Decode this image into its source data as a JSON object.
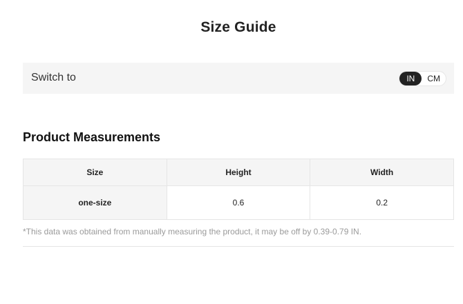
{
  "page": {
    "title": "Size Guide"
  },
  "switch": {
    "label": "Switch to",
    "options": [
      "IN",
      "CM"
    ],
    "selected": "IN"
  },
  "measurements": {
    "title": "Product Measurements",
    "columns": [
      "Size",
      "Height",
      "Width"
    ],
    "rows": [
      [
        "one-size",
        "0.6",
        "0.2"
      ]
    ],
    "note": "*This data was obtained from manually measuring the product, it may be off by 0.39-0.79 IN."
  },
  "colors": {
    "accent": "#222222",
    "panel_bg": "#f5f5f5",
    "border": "#e5e5e5",
    "note_text": "#9a9a9a"
  }
}
